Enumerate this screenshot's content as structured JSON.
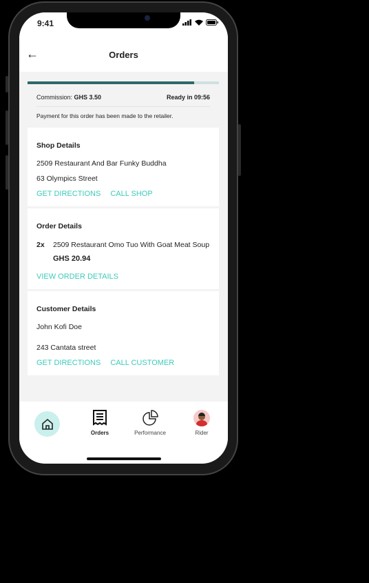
{
  "status": {
    "time": "9:41"
  },
  "header": {
    "title": "Orders",
    "back_icon": "arrow-left-icon"
  },
  "order": {
    "progress": 0.87,
    "commission_label": "Commission: ",
    "commission_value": "GHS 3.50",
    "ready": "Ready in 09:56",
    "payment_note": "Payment for this order has been made to the retailer."
  },
  "shop": {
    "title": "Shop Details",
    "name": "2509 Restaurant And Bar Funky Buddha",
    "address": "63 Olympics Street",
    "directions": "GET DIRECTIONS",
    "call": "CALL SHOP"
  },
  "order_details": {
    "title": "Order Details",
    "qty": "2x",
    "item": "2509 Restaurant Omo Tuo With Goat Meat Soup",
    "price": "GHS 20.94",
    "view": "VIEW ORDER DETAILS"
  },
  "customer": {
    "title": "Customer Details",
    "name": "John Kofi Doe",
    "address": "243 Cantata street",
    "directions": "GET DIRECTIONS",
    "call": "CALL CUSTOMER"
  },
  "nav": {
    "orders": "Orders",
    "performance": "Performance",
    "rider": "Rider"
  },
  "colors": {
    "accent": "#3ccbb8",
    "progress": "#2c6a68",
    "home_bg": "#c9f0ec"
  }
}
